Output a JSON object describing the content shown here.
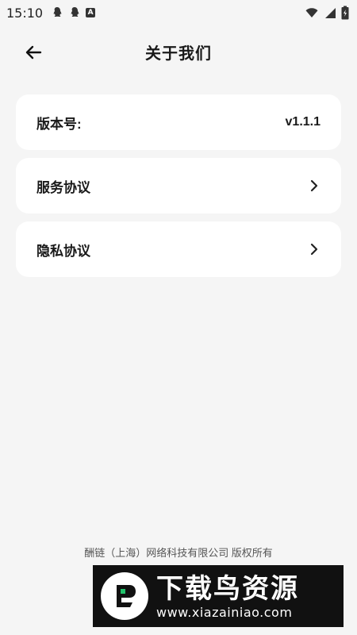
{
  "status_bar": {
    "time": "15:10",
    "left_icons": [
      "qq-icon",
      "qq-icon",
      "a-badge-icon"
    ],
    "a_badge_text": "A",
    "right_icons": [
      "wifi-icon",
      "signal-icon",
      "battery-icon"
    ]
  },
  "header": {
    "title": "关于我们",
    "back_icon": "arrow-left-icon"
  },
  "items": [
    {
      "label": "版本号:",
      "value": "v1.1.1"
    },
    {
      "label": "服务协议",
      "icon": "chevron-right-icon"
    },
    {
      "label": "隐私协议",
      "icon": "chevron-right-icon"
    }
  ],
  "footer": {
    "copyright": "酬链（上海）网络科技有限公司 版权所有"
  },
  "watermark": {
    "title": "下载鸟资源",
    "url": "www.xiazainiao.com"
  },
  "colors": {
    "background": "#f5f5f5",
    "card": "#ffffff",
    "text": "#1a1a1a",
    "footer_text": "#555555",
    "watermark_bg": "#111111",
    "watermark_accent": "#21c36b"
  }
}
